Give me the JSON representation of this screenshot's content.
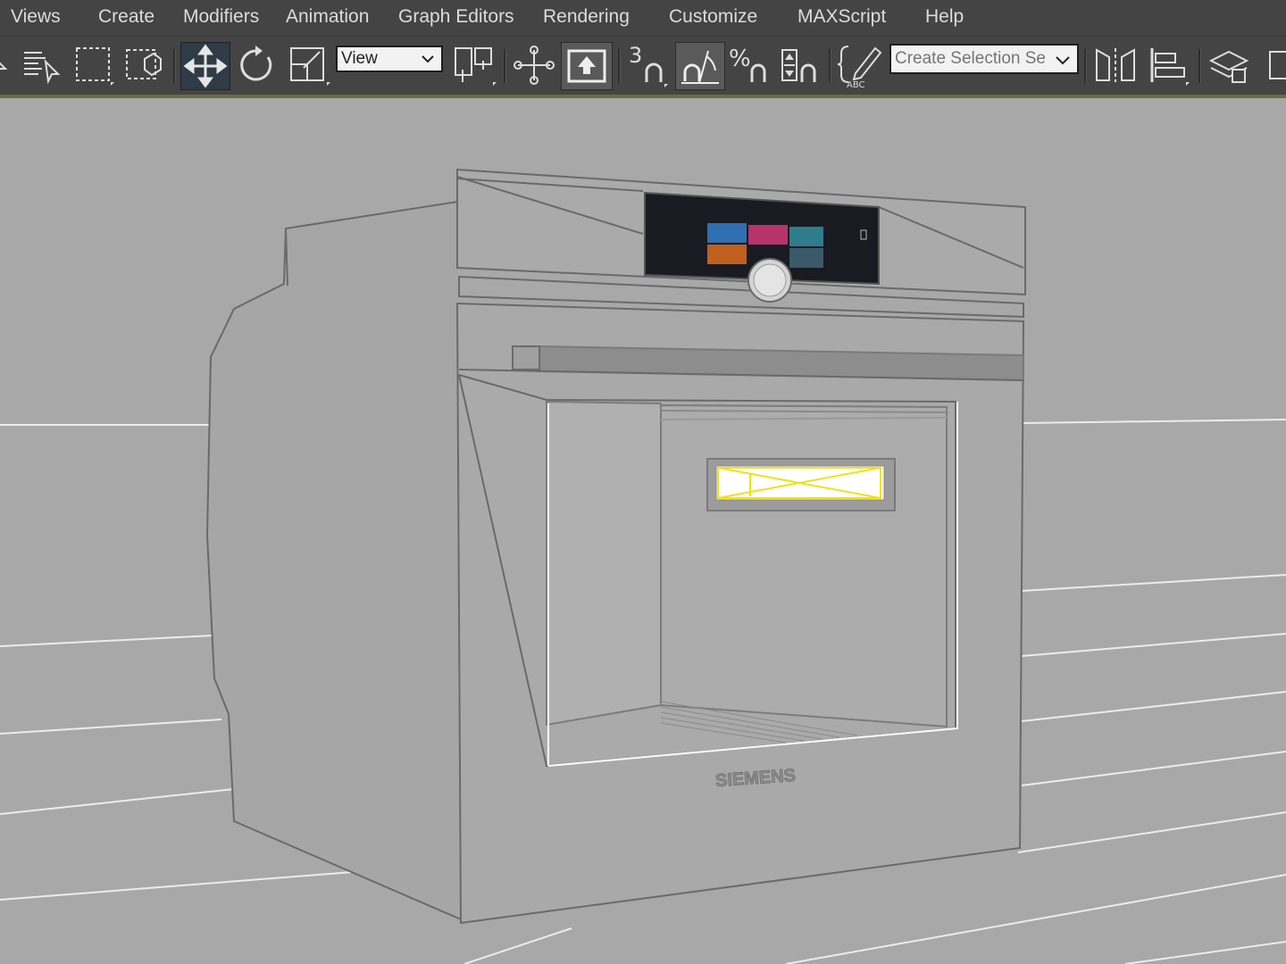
{
  "menu": {
    "items": [
      "Views",
      "Create",
      "Modifiers",
      "Animation",
      "Graph Editors",
      "Rendering",
      "Customize",
      "MAXScript",
      "Help"
    ]
  },
  "toolbar": {
    "coord_system": "View",
    "selection_set_placeholder": "Create Selection Se",
    "snap_value": "3"
  },
  "viewport": {
    "brand_label": "SIEMENS",
    "screen_tiles": [
      {
        "color": "#2f6fb0"
      },
      {
        "color": "#b8336a"
      },
      {
        "color": "#2f7d8c"
      },
      {
        "color": "#c0601e"
      },
      {
        "color": "#3a5a6a"
      }
    ],
    "selection_color": "#f0e020"
  }
}
